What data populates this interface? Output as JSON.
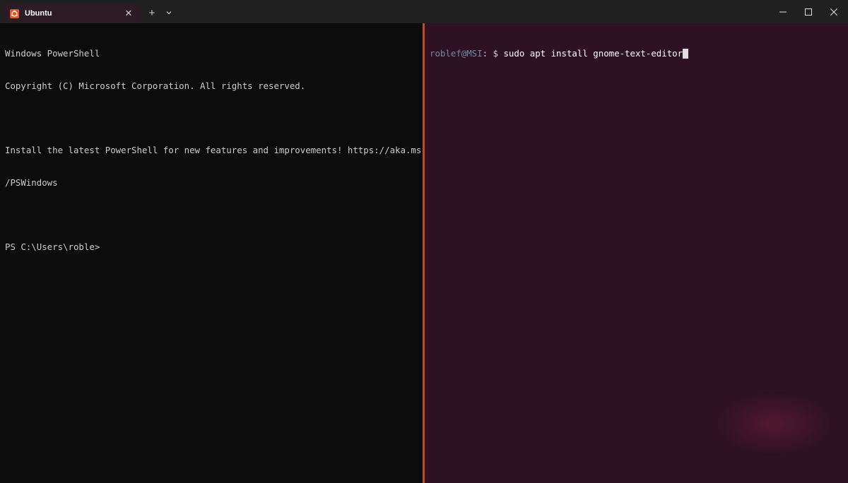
{
  "tab": {
    "title": "Ubuntu",
    "icon": "ubuntu-icon",
    "close_label": "✕",
    "color": "#e95420"
  },
  "tabbar": {
    "new_tab_label": "+",
    "dropdown_icon": "chevron-down-icon"
  },
  "window_controls": {
    "minimize_icon": "minimize-icon",
    "maximize_icon": "maximize-icon",
    "close_icon": "close-icon"
  },
  "left_pane": {
    "shell": "PowerShell",
    "lines": [
      "Windows PowerShell",
      "Copyright (C) Microsoft Corporation. All rights reserved.",
      "",
      "Install the latest PowerShell for new features and improvements! https://aka.ms",
      "/PSWindows",
      "",
      "PS C:\\Users\\roble>"
    ]
  },
  "right_pane": {
    "prompt_user": "roblef@MSI",
    "prompt_sep": ": $ ",
    "command": "sudo apt install gnome-text-editor"
  },
  "colors": {
    "titlebar": "#202020",
    "left_bg": "#0c0c0c",
    "right_bg": "#2f1124",
    "divider": "#c0492b",
    "prompt_user": "#6d8aa6"
  }
}
